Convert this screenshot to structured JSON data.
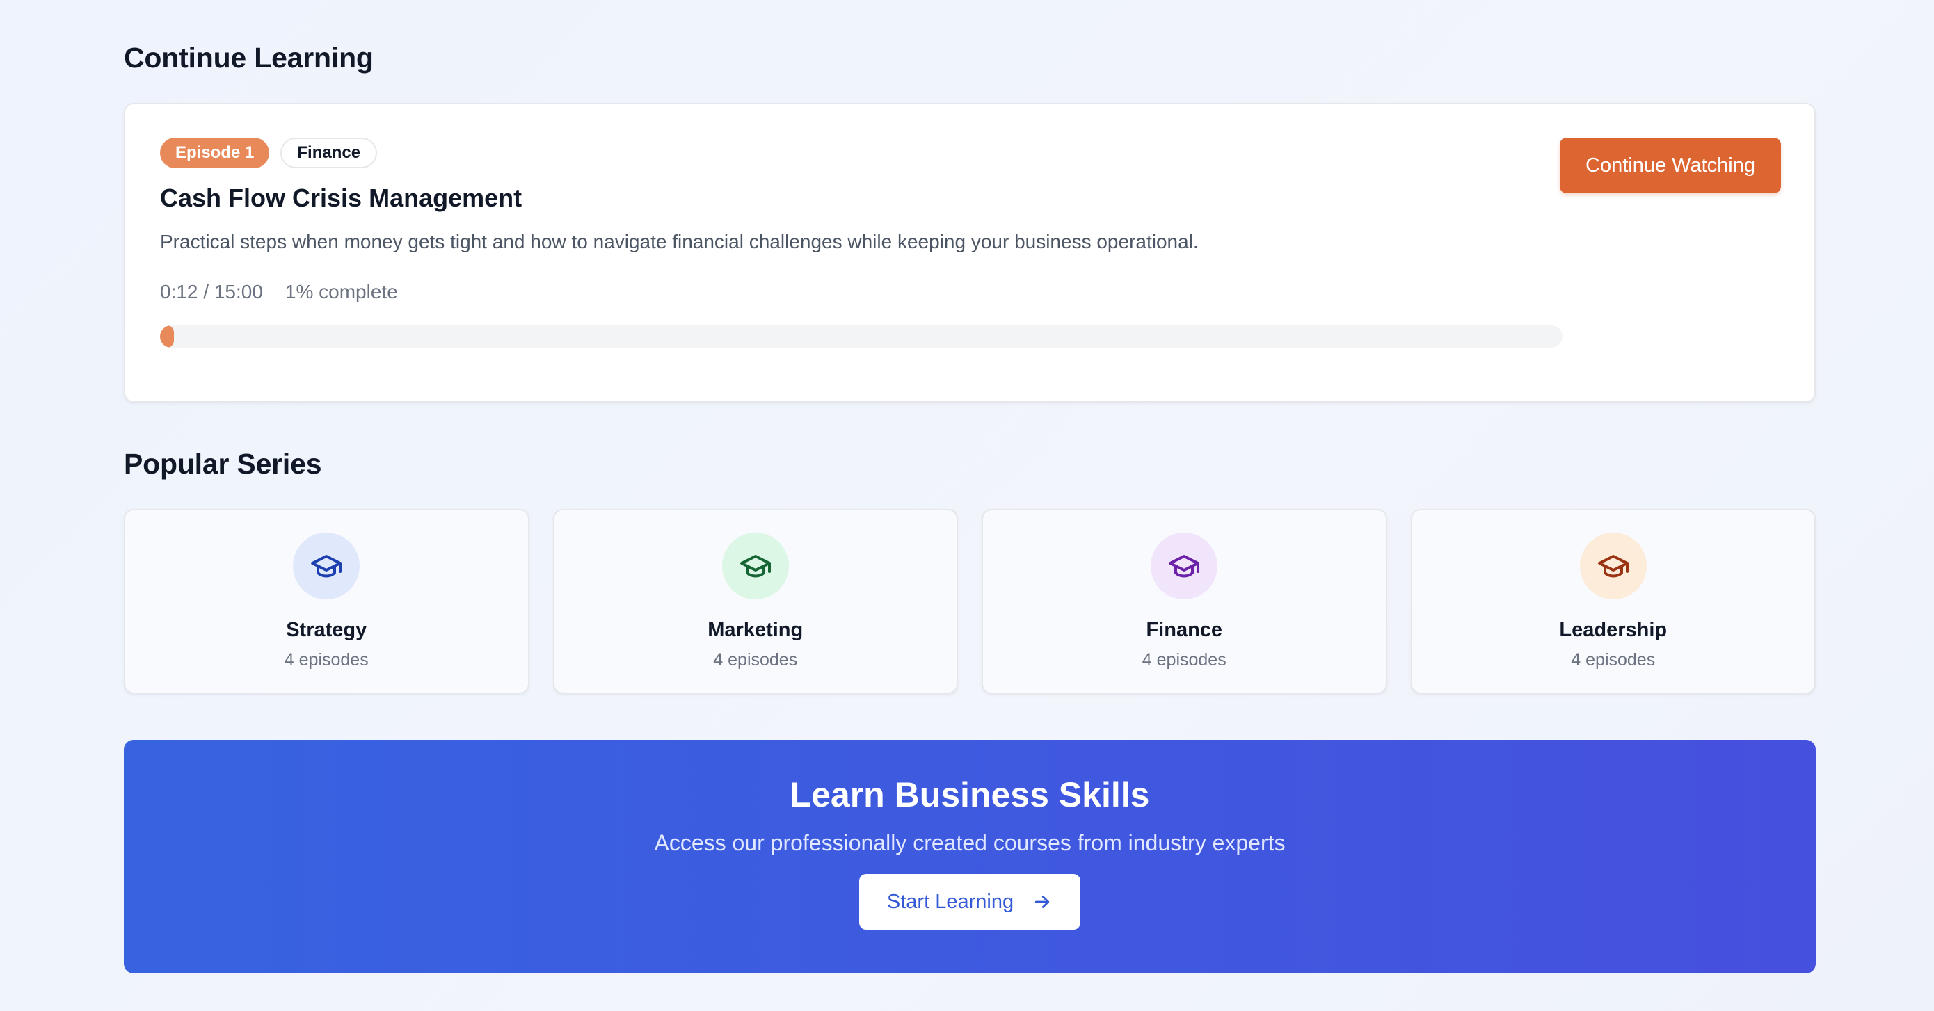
{
  "continue_section": {
    "title": "Continue Learning",
    "episode_badge": "Episode 1",
    "category_badge": "Finance",
    "episode_title": "Cash Flow Crisis Management",
    "description": "Practical steps when money gets tight and how to navigate financial challenges while keeping your business operational.",
    "time": "0:12 / 15:00",
    "percent_label": "1% complete",
    "progress_fraction": 0.01,
    "button_label": "Continue Watching",
    "colors": {
      "accent": "#dc6532",
      "badge": "#e8895a"
    }
  },
  "popular_section": {
    "title": "Popular Series",
    "series": [
      {
        "name": "Strategy",
        "count": "4 episodes",
        "icon": "graduation-cap-icon",
        "icon_bg": "#e0e9fb",
        "icon_color": "#1e40af"
      },
      {
        "name": "Marketing",
        "count": "4 episodes",
        "icon": "graduation-cap-icon",
        "icon_bg": "#dcf7e5",
        "icon_color": "#166534"
      },
      {
        "name": "Finance",
        "count": "4 episodes",
        "icon": "graduation-cap-icon",
        "icon_bg": "#f0e5fb",
        "icon_color": "#6b21a8"
      },
      {
        "name": "Leadership",
        "count": "4 episodes",
        "icon": "graduation-cap-icon",
        "icon_bg": "#fcecd9",
        "icon_color": "#9a3412"
      }
    ]
  },
  "cta": {
    "title": "Learn Business Skills",
    "subtitle": "Access our professionally created courses from industry experts",
    "button_label": "Start Learning",
    "button_icon": "arrow-right-icon"
  }
}
